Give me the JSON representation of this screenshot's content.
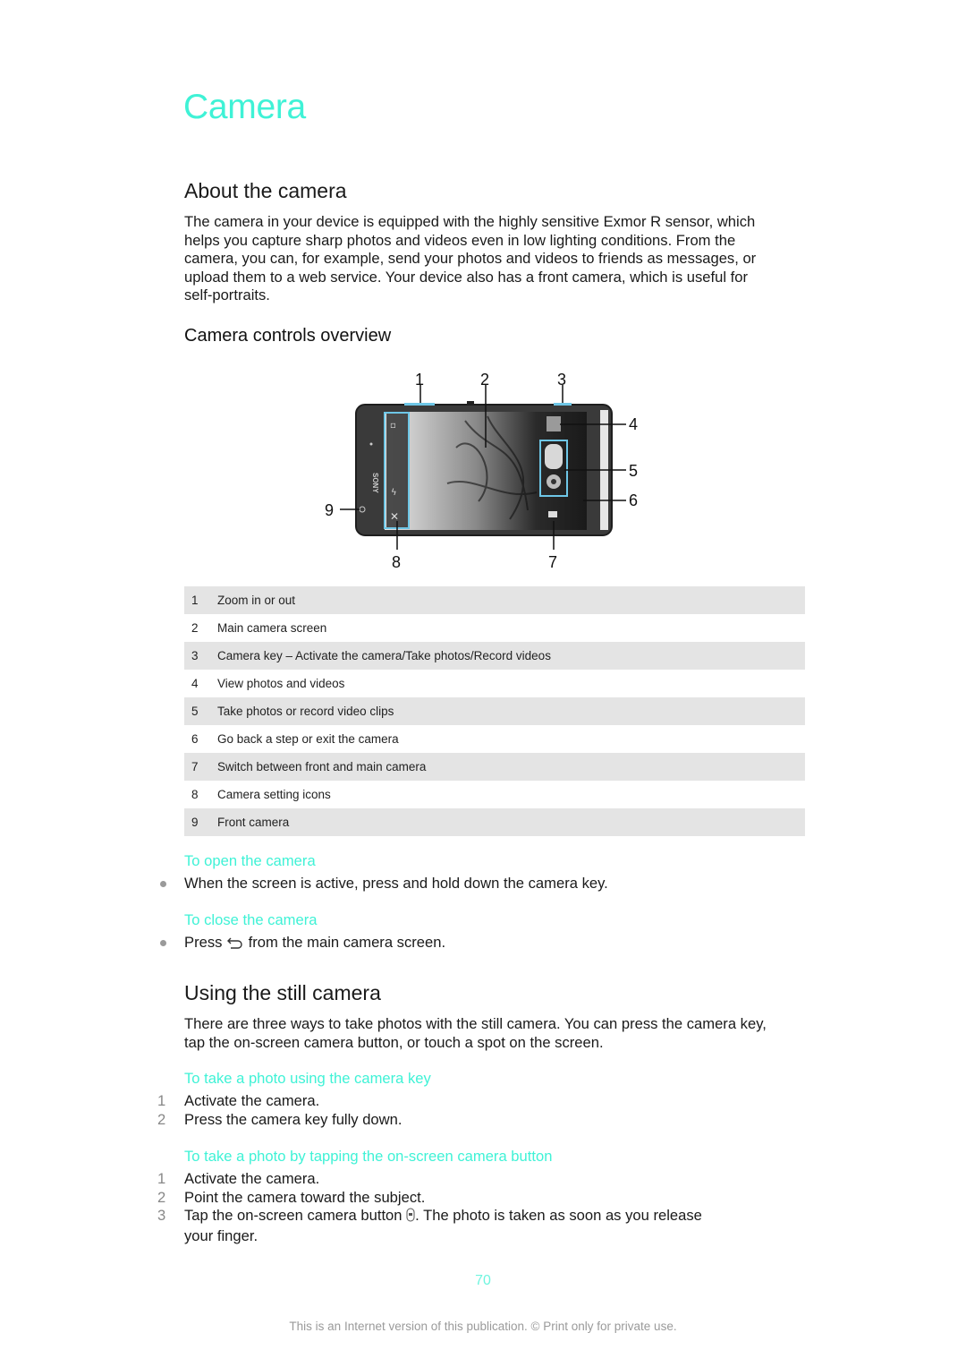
{
  "chapter_title": "Camera",
  "sections": {
    "about": {
      "heading": "About the camera",
      "paragraph_lines": [
        "The camera in your device is equipped with the highly sensitive Exmor R sensor, which",
        "helps you capture sharp photos and videos even in low lighting conditions. From the",
        "camera, you can, for example, send your photos and videos to friends as messages, or",
        "upload them to a web service. Your device also has a front camera, which is useful for",
        "self-portraits."
      ]
    },
    "controls": {
      "heading": "Camera controls overview",
      "figure": {
        "brand_label": "SONY",
        "callouts": [
          "1",
          "2",
          "3",
          "4",
          "5",
          "6",
          "7",
          "8",
          "9"
        ],
        "highlight_color": "#6ec6e6"
      },
      "table": [
        {
          "num": "1",
          "text": "Zoom in or out"
        },
        {
          "num": "2",
          "text": "Main camera screen"
        },
        {
          "num": "3",
          "text": "Camera key – Activate the camera/Take photos/Record videos"
        },
        {
          "num": "4",
          "text": "View photos and videos"
        },
        {
          "num": "5",
          "text": "Take photos or record video clips"
        },
        {
          "num": "6",
          "text": "Go back a step or exit the camera"
        },
        {
          "num": "7",
          "text": "Switch between front and main camera"
        },
        {
          "num": "8",
          "text": "Camera setting icons"
        },
        {
          "num": "9",
          "text": "Front camera"
        }
      ]
    },
    "open": {
      "title": "To open the camera",
      "bullet": "When the screen is active, press and hold down the camera key."
    },
    "close": {
      "title": "To close the camera",
      "bullet_before": "Press",
      "bullet_icon": "back-icon",
      "bullet_after": "from the main camera screen."
    },
    "still": {
      "heading": "Using the still camera",
      "paragraph_lines": [
        "There are three ways to take photos with the still camera. You can press the camera key,",
        "tap the on-screen camera button, or touch a spot on the screen."
      ],
      "proc1": {
        "title": "To take a photo using the camera key",
        "steps": [
          {
            "num": "1",
            "text": "Activate the camera."
          },
          {
            "num": "2",
            "text": "Press the camera key fully down."
          }
        ]
      },
      "proc2": {
        "title": "To take a photo by tapping the on-screen camera button",
        "steps": [
          {
            "num": "1",
            "text": "Activate the camera."
          },
          {
            "num": "2",
            "text": "Point the camera toward the subject."
          },
          {
            "num": "3",
            "text_before": "Tap the on-screen camera button",
            "icon": "camera-button-icon",
            "text_after": ". The photo is taken as soon as you release",
            "text_line2": "your finger."
          }
        ]
      }
    }
  },
  "page_number": "70",
  "footer": "This is an Internet version of this publication. © Print only for private use.",
  "colors": {
    "accent": "#3ff2d6",
    "table_shade": "#e4e4e4",
    "footer_text": "#9a9a9a"
  }
}
